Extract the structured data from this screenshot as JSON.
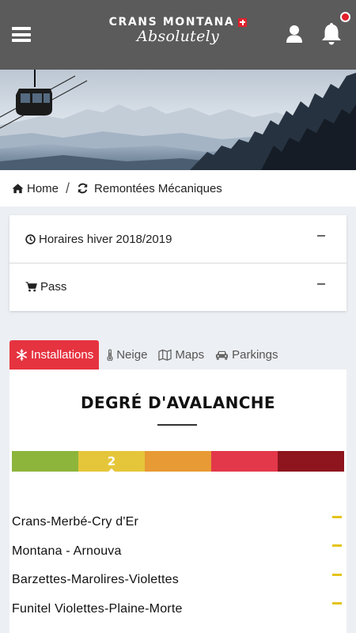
{
  "header": {
    "logo_top": "CRANS MONTANA",
    "logo_script": "Absolutely"
  },
  "breadcrumb": {
    "home": "Home",
    "current": "Remontées Mécaniques"
  },
  "accordion": [
    {
      "label": "Horaires hiver 2018/2019",
      "icon": "clock-icon"
    },
    {
      "label": "Pass",
      "icon": "cart-icon"
    }
  ],
  "tabs": [
    {
      "label": "Installations",
      "icon": "snowflake-icon",
      "active": true
    },
    {
      "label": "Neige",
      "icon": "thermometer-icon",
      "active": false
    },
    {
      "label": "Maps",
      "icon": "map-icon",
      "active": false
    },
    {
      "label": "Parkings",
      "icon": "car-icon",
      "active": false
    }
  ],
  "avalanche": {
    "title": "DEGRÉ D'AVALANCHE",
    "current_level": "2",
    "levels": [
      {
        "level": 1,
        "color": "#8db53b"
      },
      {
        "level": 2,
        "color": "#e5c63a"
      },
      {
        "level": 3,
        "color": "#e89a35"
      },
      {
        "level": 4,
        "color": "#e2384a"
      },
      {
        "level": 5,
        "color": "#8e141e"
      }
    ]
  },
  "lifts": [
    {
      "name": "Crans-Merbé-Cry d'Er",
      "status_color": "#e5c318"
    },
    {
      "name": "Montana - Arnouva",
      "status_color": "#e5c318"
    },
    {
      "name": "Barzettes-Marolires-Violettes",
      "status_color": "#e5c318"
    },
    {
      "name": "Funitel Violettes-Plaine-Morte",
      "status_color": "#e5c318"
    }
  ],
  "colors": {
    "header_bg": "#5b5b5b",
    "accent": "#e63340",
    "notification": "#e2202b"
  }
}
